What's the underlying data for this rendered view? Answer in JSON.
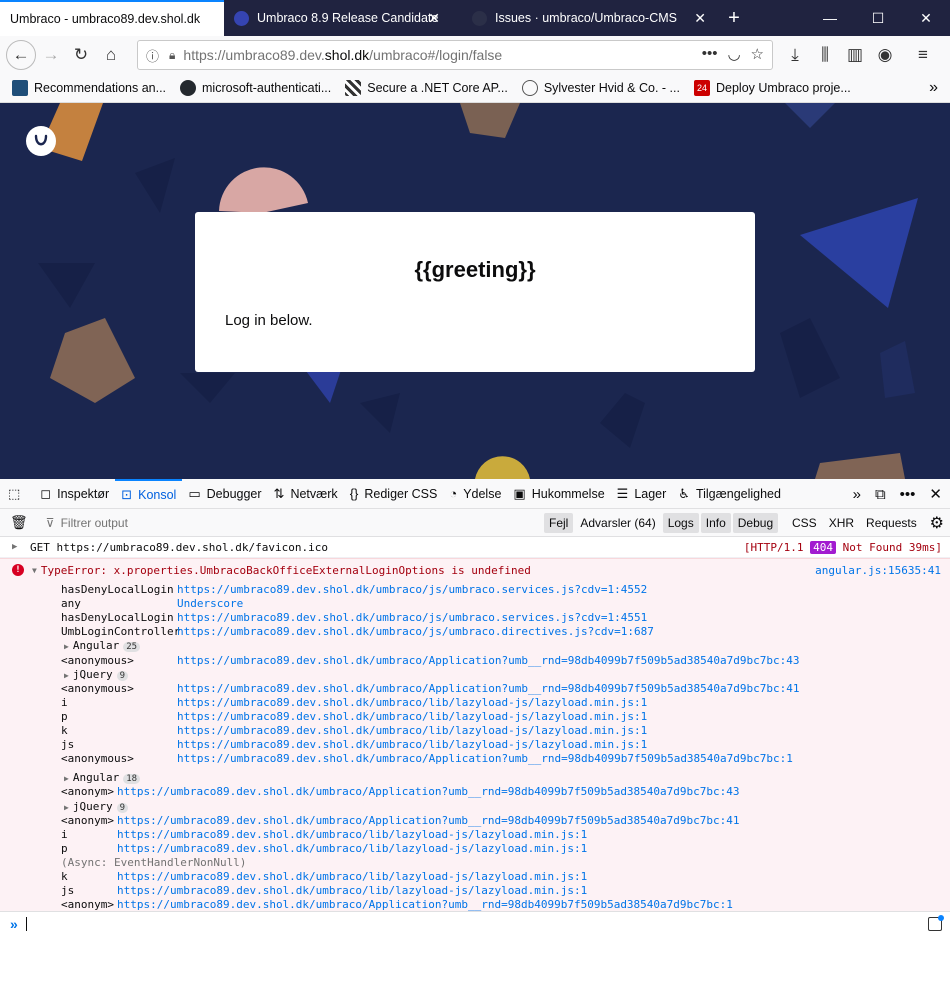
{
  "tabs": [
    {
      "title": "Umbraco - umbraco89.dev.shol.dk",
      "active": true
    },
    {
      "title": "Umbraco 8.9 Release Candidate",
      "active": false
    },
    {
      "title": "Issues · umbraco/Umbraco-CMS",
      "active": false
    }
  ],
  "url": {
    "prefix": "https://umbraco89.dev.",
    "domain": "shol.dk",
    "suffix": "/umbraco#/login/false"
  },
  "bookmarks": [
    {
      "label": "Recommendations an..."
    },
    {
      "label": "microsoft-authenticati..."
    },
    {
      "label": "Secure a .NET Core AP..."
    },
    {
      "label": "Sylvester Hvid & Co. - ..."
    },
    {
      "label": "Deploy Umbraco proje..."
    }
  ],
  "login": {
    "greeting": "{{greeting}}",
    "text": "Log in below."
  },
  "devtools": {
    "tabs": [
      "Inspektør",
      "Konsol",
      "Debugger",
      "Netværk",
      "Rediger CSS",
      "Ydelse",
      "Hukommelse",
      "Lager",
      "Tilgængelighed"
    ],
    "filter_placeholder": "Filtrer output",
    "levels": [
      "Fejl",
      "Advarsler (64)",
      "Logs",
      "Info",
      "Debug"
    ],
    "types": [
      "CSS",
      "XHR",
      "Requests"
    ]
  },
  "console": {
    "get": {
      "text": "GET https://umbraco89.dev.shol.dk/favicon.ico",
      "http": "[HTTP/1.1",
      "code": "404",
      "status": "Not Found 39ms]"
    },
    "error": {
      "text": "TypeError: x.properties.UmbracoBackOfficeExternalLoginOptions is undefined",
      "location": "angular.js:15635:41",
      "frames1": [
        {
          "fn": "hasDenyLocalLogin",
          "loc": "https://umbraco89.dev.shol.dk/umbraco/js/umbraco.services.js?cdv=1:4552"
        },
        {
          "fn": "any",
          "loc": "Underscore"
        },
        {
          "fn": "hasDenyLocalLogin",
          "loc": "https://umbraco89.dev.shol.dk/umbraco/js/umbraco.services.js?cdv=1:4551"
        },
        {
          "fn": "UmbLoginController",
          "loc": "https://umbraco89.dev.shol.dk/umbraco/js/umbraco.directives.js?cdv=1:687"
        }
      ],
      "group_angular1": {
        "name": "Angular",
        "count": "25"
      },
      "frame_anon1": {
        "fn": "<anonymous>",
        "loc": "https://umbraco89.dev.shol.dk/umbraco/Application?umb__rnd=98db4099b7f509b5ad38540a7d9bc7bc:43"
      },
      "group_jquery1": {
        "name": "jQuery",
        "count": "9"
      },
      "frames2": [
        {
          "fn": "<anonymous>",
          "loc": "https://umbraco89.dev.shol.dk/umbraco/Application?umb__rnd=98db4099b7f509b5ad38540a7d9bc7bc:41"
        },
        {
          "fn": "i",
          "loc": "https://umbraco89.dev.shol.dk/umbraco/lib/lazyload-js/lazyload.min.js:1"
        },
        {
          "fn": "p",
          "loc": "https://umbraco89.dev.shol.dk/umbraco/lib/lazyload-js/lazyload.min.js:1"
        },
        {
          "fn": "k",
          "loc": "https://umbraco89.dev.shol.dk/umbraco/lib/lazyload-js/lazyload.min.js:1"
        },
        {
          "fn": "js",
          "loc": "https://umbraco89.dev.shol.dk/umbraco/lib/lazyload-js/lazyload.min.js:1"
        },
        {
          "fn": "<anonymous>",
          "loc": "https://umbraco89.dev.shol.dk/umbraco/Application?umb__rnd=98db4099b7f509b5ad38540a7d9bc7bc:1"
        }
      ],
      "group_angular2": {
        "name": "Angular",
        "count": "18"
      },
      "frame_anon2": {
        "fn": "<anonym>",
        "loc": "https://umbraco89.dev.shol.dk/umbraco/Application?umb__rnd=98db4099b7f509b5ad38540a7d9bc7bc:43"
      },
      "group_jquery2": {
        "name": "jQuery",
        "count": "9"
      },
      "frames3": [
        {
          "fn": "<anonym>",
          "loc": "https://umbraco89.dev.shol.dk/umbraco/Application?umb__rnd=98db4099b7f509b5ad38540a7d9bc7bc:41"
        },
        {
          "fn": "i",
          "loc": "https://umbraco89.dev.shol.dk/umbraco/lib/lazyload-js/lazyload.min.js:1"
        },
        {
          "fn": "p",
          "loc": "https://umbraco89.dev.shol.dk/umbraco/lib/lazyload-js/lazyload.min.js:1"
        }
      ],
      "async": "(Async: EventHandlerNonNull)",
      "frames4": [
        {
          "fn": "k",
          "loc": "https://umbraco89.dev.shol.dk/umbraco/lib/lazyload-js/lazyload.min.js:1"
        },
        {
          "fn": "js",
          "loc": "https://umbraco89.dev.shol.dk/umbraco/lib/lazyload-js/lazyload.min.js:1"
        },
        {
          "fn": "<anonym>",
          "loc": "https://umbraco89.dev.shol.dk/umbraco/Application?umb__rnd=98db4099b7f509b5ad38540a7d9bc7bc:1"
        }
      ]
    }
  },
  "colors": {
    "page_bg": "#1b264f",
    "accent": "#0a84ff",
    "error_bg": "#fdf2f5",
    "error_text": "#a4000f",
    "link": "#0074e8"
  }
}
